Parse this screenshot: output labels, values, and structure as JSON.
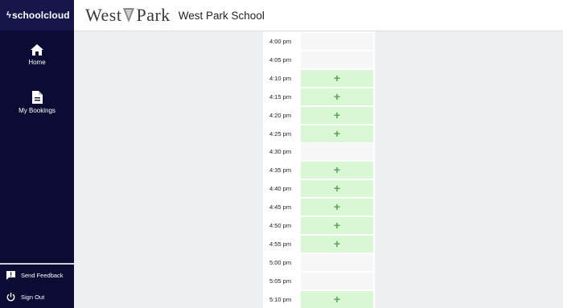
{
  "brand": {
    "name": "schoolcloud",
    "bolt": "ϟ"
  },
  "sidebar": {
    "items": [
      {
        "label": "Home",
        "icon": "home-icon"
      },
      {
        "label": "My Bookings",
        "icon": "document-icon"
      }
    ],
    "footer": [
      {
        "label": "Send Feedback",
        "icon": "feedback-icon"
      },
      {
        "label": "Sign Out",
        "icon": "power-icon"
      }
    ]
  },
  "header": {
    "logo_left": "West",
    "logo_right": "Park",
    "school_name": "West Park School"
  },
  "slots": [
    {
      "time": "4:00 pm",
      "available": false,
      "action": ""
    },
    {
      "time": "4:05 pm",
      "available": false,
      "action": ""
    },
    {
      "time": "4:10 pm",
      "available": true,
      "action": "+"
    },
    {
      "time": "4:15 pm",
      "available": true,
      "action": "+"
    },
    {
      "time": "4:20 pm",
      "available": true,
      "action": "+"
    },
    {
      "time": "4:25 pm",
      "available": true,
      "action": "+"
    },
    {
      "time": "4:30 pm",
      "available": false,
      "action": ""
    },
    {
      "time": "4:35 pm",
      "available": true,
      "action": "+"
    },
    {
      "time": "4:40 pm",
      "available": true,
      "action": "+"
    },
    {
      "time": "4:45 pm",
      "available": true,
      "action": "+"
    },
    {
      "time": "4:50 pm",
      "available": true,
      "action": "+"
    },
    {
      "time": "4:55 pm",
      "available": true,
      "action": "+"
    },
    {
      "time": "5:00 pm",
      "available": false,
      "action": ""
    },
    {
      "time": "5:05 pm",
      "available": false,
      "action": ""
    },
    {
      "time": "5:10 pm",
      "available": true,
      "action": "+"
    }
  ],
  "colors": {
    "sidebar_bg": "#0b0b33",
    "available_bg": "#d9f7d4",
    "plus": "#59a653",
    "unavailable_bg": "#f7f7f7"
  }
}
